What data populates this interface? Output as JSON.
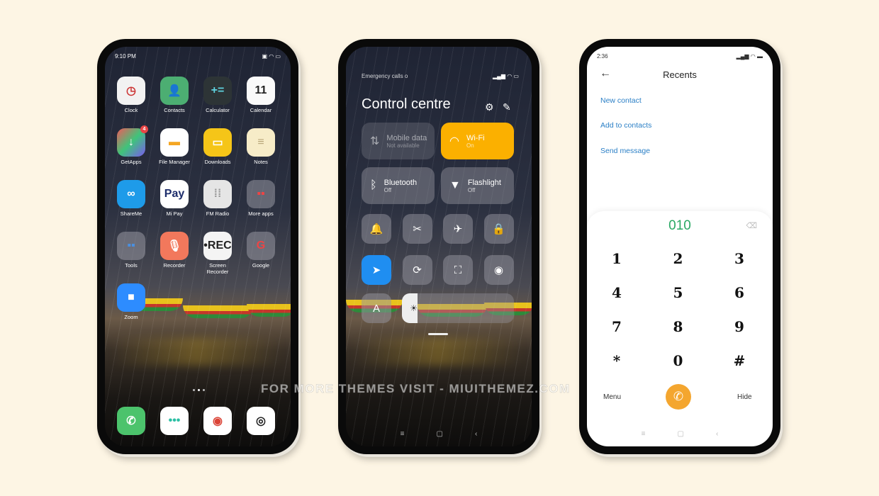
{
  "home": {
    "time": "9:10 PM",
    "apps": [
      {
        "label": "Clock",
        "icon": "clock-icon",
        "glyph": "◷",
        "bg": "#f2f2f2",
        "fg": "#c33"
      },
      {
        "label": "Contacts",
        "icon": "contacts-icon",
        "glyph": "👤",
        "bg": "#4cae72",
        "fg": "#fff"
      },
      {
        "label": "Calculator",
        "icon": "calculator-icon",
        "glyph": "+=",
        "bg": "#2d3436",
        "fg": "#5fd3e0"
      },
      {
        "label": "Calendar",
        "icon": "calendar-icon",
        "glyph": "11",
        "bg": "#fafafa",
        "fg": "#222"
      },
      {
        "label": "GetApps",
        "icon": "getapps-icon",
        "glyph": "↓",
        "bg": "linear-gradient(135deg,#f05a5a,#3fc47a,#7a5af0)",
        "fg": "#fff",
        "badge": "4"
      },
      {
        "label": "File Manager",
        "icon": "folder-icon",
        "glyph": "▬",
        "bg": "#fff",
        "fg": "#f4a623"
      },
      {
        "label": "Downloads",
        "icon": "downloads-icon",
        "glyph": "▭",
        "bg": "#f5c518",
        "fg": "#fff"
      },
      {
        "label": "Notes",
        "icon": "notes-icon",
        "glyph": "≡",
        "bg": "#f7ecc8",
        "fg": "#b9a77a"
      },
      {
        "label": "ShareMe",
        "icon": "shareme-icon",
        "glyph": "∞",
        "bg": "#1e9be9",
        "fg": "#fff"
      },
      {
        "label": "Mi Pay",
        "icon": "mipay-icon",
        "glyph": "Pay",
        "bg": "#fff",
        "fg": "#1d2d6b"
      },
      {
        "label": "FM Radio",
        "icon": "radio-icon",
        "glyph": "⁞⁞",
        "bg": "#e5e5e5",
        "fg": "#999"
      },
      {
        "label": "More apps",
        "icon": "folder-more-apps-icon",
        "glyph": "▪▪",
        "bg": "rgba(160,160,170,.5)",
        "fg": "#e44"
      },
      {
        "label": "Tools",
        "icon": "folder-tools-icon",
        "glyph": "▪▪",
        "bg": "rgba(160,160,170,.5)",
        "fg": "#4a8fe0"
      },
      {
        "label": "Recorder",
        "icon": "microphone-icon",
        "glyph": "🎙",
        "bg": "#f2785c",
        "fg": "#fff"
      },
      {
        "label": "Screen Recorder",
        "icon": "screen-recorder-icon",
        "glyph": "•REC",
        "bg": "#f4f4f4",
        "fg": "#222"
      },
      {
        "label": "Google",
        "icon": "folder-google-icon",
        "glyph": "G",
        "bg": "rgba(160,160,170,.5)",
        "fg": "#e44"
      },
      {
        "label": "Zoom",
        "icon": "zoom-icon",
        "glyph": "■",
        "bg": "#2d8cff",
        "fg": "#fff"
      }
    ],
    "dock": [
      {
        "icon": "phone-icon",
        "glyph": "✆",
        "bg": "#4cc36c",
        "fg": "#fff"
      },
      {
        "icon": "messages-icon",
        "glyph": "•••",
        "bg": "#fff",
        "fg": "#2bbfa4"
      },
      {
        "icon": "chrome-icon",
        "glyph": "◉",
        "bg": "#fff",
        "fg": "#db4437"
      },
      {
        "icon": "camera-icon",
        "glyph": "◎",
        "bg": "#fff",
        "fg": "#222"
      }
    ]
  },
  "control": {
    "status": "Emergency calls o",
    "title": "Control centre",
    "tiles": [
      {
        "name": "mobile-data",
        "label": "Mobile data",
        "sub": "Not available",
        "glyph": "⇅"
      },
      {
        "name": "wifi",
        "label": "Wi-Fi",
        "sub": "On",
        "glyph": "◠",
        "active": true
      },
      {
        "name": "bluetooth",
        "label": "Bluetooth",
        "sub": "Off",
        "glyph": "ᛒ"
      },
      {
        "name": "flashlight",
        "label": "Flashlight",
        "sub": "Off",
        "glyph": "▼"
      }
    ],
    "toggles": [
      {
        "icon": "bell-icon",
        "glyph": "🔔"
      },
      {
        "icon": "screenshot-icon",
        "glyph": "✂"
      },
      {
        "icon": "airplane-icon",
        "glyph": "✈"
      },
      {
        "icon": "lock-icon",
        "glyph": "🔒"
      },
      {
        "icon": "location-icon",
        "glyph": "➤",
        "active": true
      },
      {
        "icon": "rotation-lock-icon",
        "glyph": "⟳"
      },
      {
        "icon": "scan-icon",
        "glyph": "⛶"
      },
      {
        "icon": "eye-icon",
        "glyph": "◉"
      }
    ],
    "auto_brightness": "A",
    "accent": "#fbb000"
  },
  "dialer": {
    "time": "2:36",
    "title": "Recents",
    "links": [
      "New contact",
      "Add to contacts",
      "Send message"
    ],
    "number": "010",
    "keys": [
      "1",
      "2",
      "3",
      "4",
      "5",
      "6",
      "7",
      "8",
      "9",
      "*",
      "0",
      "#"
    ],
    "menu": "Menu",
    "hide": "Hide",
    "accent": "#2aa864",
    "call_color": "#f4a62f"
  },
  "watermark": "FOR MORE THEMES VISIT - MIUITHEMEZ.COM"
}
